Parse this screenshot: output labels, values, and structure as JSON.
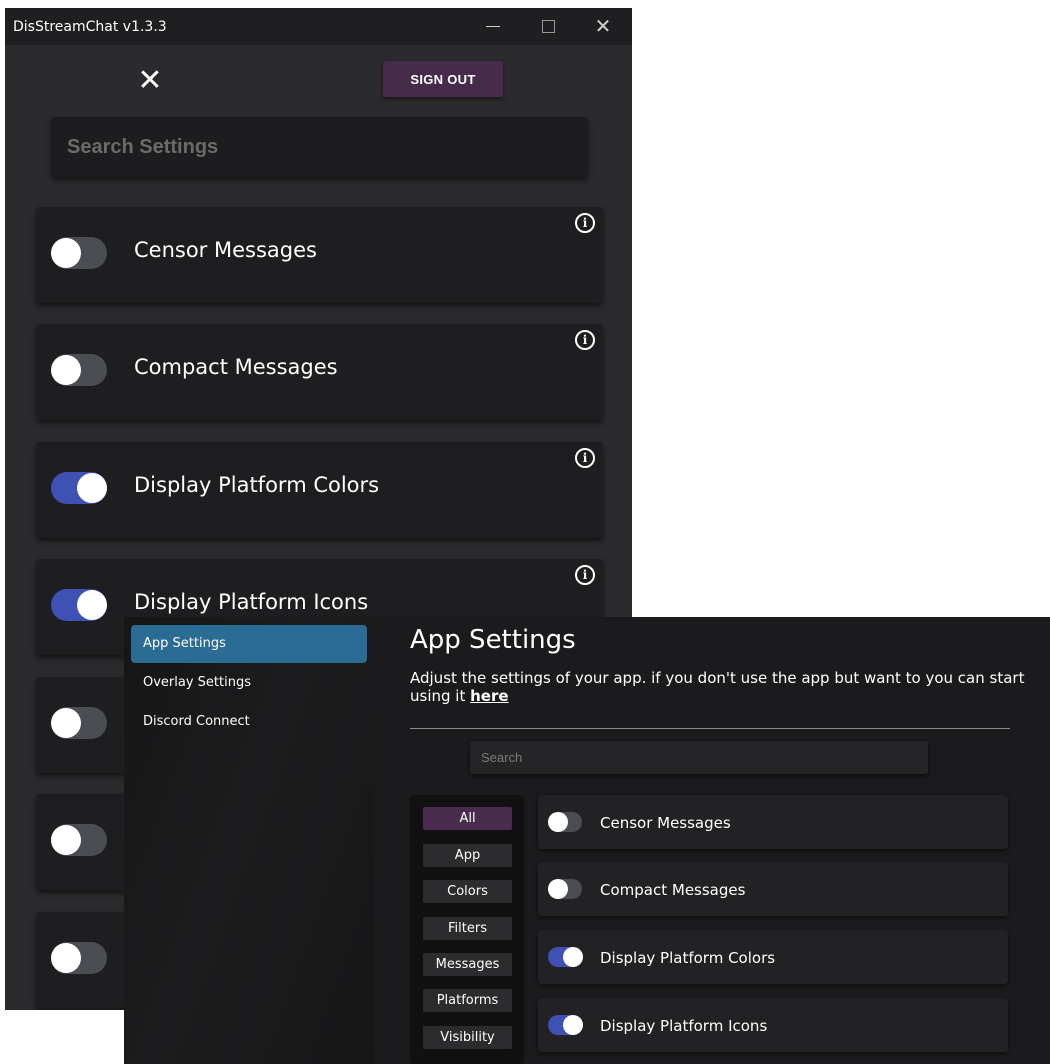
{
  "window": {
    "title": "DisStreamChat v1.3.3",
    "sign_out_label": "SIGN OUT",
    "search_placeholder": "Search Settings",
    "settings": [
      {
        "label": "Censor Messages",
        "enabled": false
      },
      {
        "label": "Compact Messages",
        "enabled": false
      },
      {
        "label": "Display Platform Colors",
        "enabled": true
      },
      {
        "label": "Display Platform Icons",
        "enabled": true
      },
      {
        "label": "",
        "enabled": false
      },
      {
        "label": "",
        "enabled": false
      },
      {
        "label": "",
        "enabled": false
      }
    ]
  },
  "web": {
    "nav": [
      {
        "label": "App Settings",
        "active": true
      },
      {
        "label": "Overlay Settings",
        "active": false
      },
      {
        "label": "Discord Connect",
        "active": false
      }
    ],
    "title": "App Settings",
    "description": "Adjust the settings of your app. if you don't use the app but want to you can start using it",
    "description_link": "here",
    "search_placeholder": "Search",
    "categories": [
      {
        "label": "All",
        "active": true
      },
      {
        "label": "App",
        "active": false
      },
      {
        "label": "Colors",
        "active": false
      },
      {
        "label": "Filters",
        "active": false
      },
      {
        "label": "Messages",
        "active": false
      },
      {
        "label": "Platforms",
        "active": false
      },
      {
        "label": "Visibility",
        "active": false
      }
    ],
    "settings": [
      {
        "label": "Censor Messages",
        "enabled": false
      },
      {
        "label": "Compact Messages",
        "enabled": false
      },
      {
        "label": "Display Platform Colors",
        "enabled": true
      },
      {
        "label": "Display Platform Icons",
        "enabled": true
      }
    ]
  },
  "colors": {
    "toggle_on": "#3f51b5",
    "toggle_off": "#4a4d52",
    "sign_out_bg": "#462b4a",
    "nav_active": "#2a6c94",
    "category_active": "#4a2c4e"
  },
  "icons": {
    "close": "close-icon",
    "info": "info-icon",
    "minimize": "minimize-icon",
    "maximize": "maximize-icon"
  }
}
